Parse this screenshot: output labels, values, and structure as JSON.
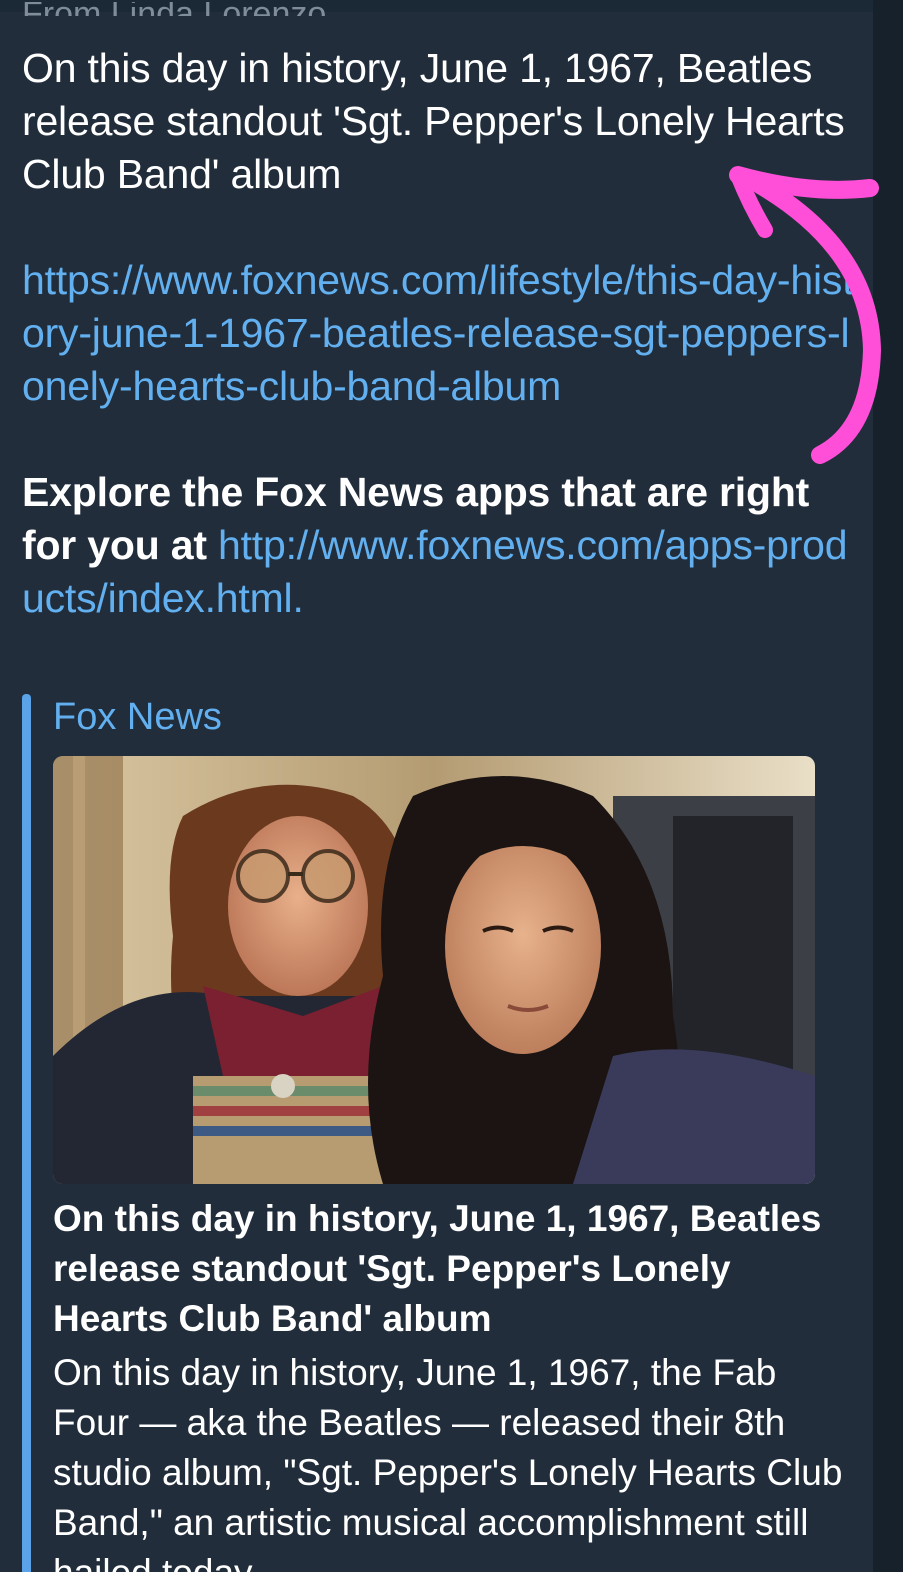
{
  "message": {
    "sender_partial": "From Linda Lorenzo",
    "headline": "On this day in history, June 1, 1967, Beatles release standout 'Sgt. Pepper's Lonely Hearts Club Band' album",
    "article_link": "https://www.foxnews.com/lifestyle/this-day-history-june-1-1967-beatles-release-sgt-peppers-lonely-hearts-club-band-album",
    "explore_prefix": "Explore the Fox News apps that are right for you at ",
    "apps_link": "http://www.foxnews.com/apps-products/index.html."
  },
  "preview": {
    "site_name": "Fox News",
    "title": "On this day in history, June 1, 1967, Beatles release standout 'Sgt. Pepper's Lonely Hearts Club Band' album",
    "description": "On this day in history, June 1, 1967, the Fab Four — aka the Beatles — released their 8th studio album, \"Sgt. Pepper's Lonely Hearts Club Band,\" an artistic musical accomplishment still hailed today"
  },
  "colors": {
    "background": "#1a2530",
    "bubble": "#212d3b",
    "link": "#62b0f0",
    "accent_bar": "#5aa3e8",
    "annotation": "#ff4fd8"
  },
  "icons": {
    "annotation": "hand-drawn-arrow"
  }
}
